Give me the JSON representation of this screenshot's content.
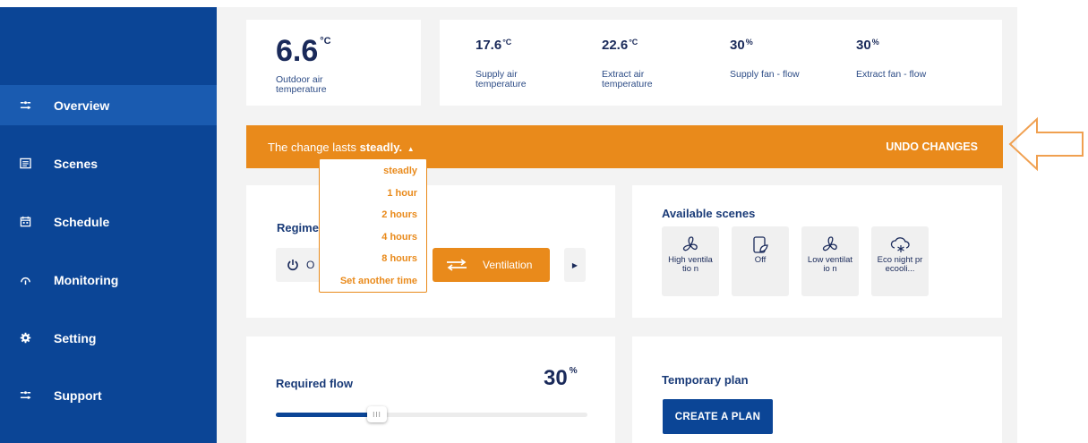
{
  "sidebar": {
    "items": [
      {
        "label": "Overview",
        "icon": "sliders-icon",
        "active": true
      },
      {
        "label": "Scenes",
        "icon": "list-icon",
        "active": false
      },
      {
        "label": "Schedule",
        "icon": "calendar-icon",
        "active": false
      },
      {
        "label": "Monitoring",
        "icon": "gauge-icon",
        "active": false
      },
      {
        "label": "Setting",
        "icon": "gear-icon",
        "active": false
      },
      {
        "label": "Support",
        "icon": "sliders-icon",
        "active": false
      }
    ]
  },
  "outdoor": {
    "value": "6.6",
    "unit": "°C",
    "label": "Outdoor air temperature"
  },
  "stats": [
    {
      "value": "17.6",
      "unit": "°C",
      "label": "Supply air temperature"
    },
    {
      "value": "22.6",
      "unit": "°C",
      "label": "Extract air temperature"
    },
    {
      "value": "30",
      "unit": "%",
      "label": "Supply fan - flow"
    },
    {
      "value": "30",
      "unit": "%",
      "label": "Extract fan - flow"
    }
  ],
  "banner": {
    "prefix": "The change lasts ",
    "selected": "steadly.",
    "undo_label": "UNDO CHANGES"
  },
  "duration_dropdown": {
    "options": [
      "steadly",
      "1 hour",
      "2 hours",
      "4 hours",
      "8 hours",
      "Set another time"
    ]
  },
  "regime": {
    "title": "Regime",
    "off_label": "O",
    "active_label": "Ventilation"
  },
  "scenes": {
    "title": "Available scenes",
    "items": [
      {
        "label": "High ventilatio n",
        "icon": "fan-icon"
      },
      {
        "label": "Off",
        "icon": "leaf-icon"
      },
      {
        "label": "Low ventilatio n",
        "icon": "fan-icon"
      },
      {
        "label": "Eco night precooli...",
        "icon": "snow-cloud-icon"
      }
    ]
  },
  "flow": {
    "title": "Required flow",
    "value": "30",
    "unit": "%",
    "level_percent": 30
  },
  "plan": {
    "title": "Temporary plan",
    "button_label": "CREATE A PLAN"
  },
  "colors": {
    "sidebar": "#0b4596",
    "accent": "#e98a1b",
    "text_dark": "#1a2a5a"
  }
}
